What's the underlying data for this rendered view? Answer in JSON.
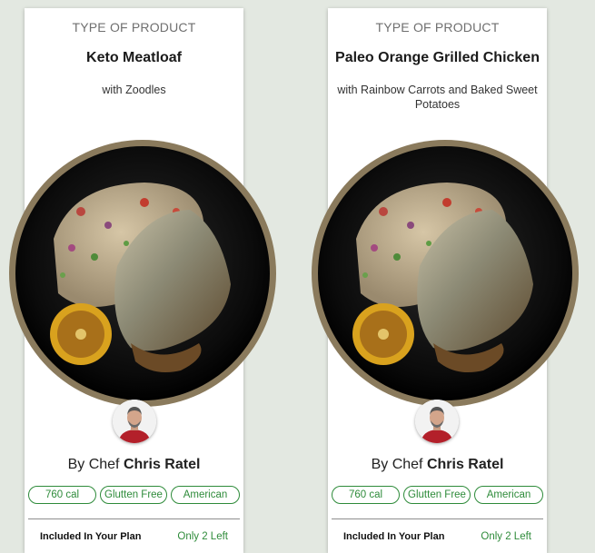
{
  "cards": [
    {
      "type_label": "TYPE OF PRODUCT",
      "title": "Keto Meatloaf",
      "subtitle": "with Zoodles",
      "chef_prefix": "By Chef",
      "chef_name": "Chris Ratel",
      "tags": [
        "760 cal",
        "Glutten Free",
        "American"
      ],
      "plan_label": "Included In Your Plan",
      "stock_label": "Only 2 Left"
    },
    {
      "type_label": "TYPE OF PRODUCT",
      "title": "Paleo Orange Grilled Chicken",
      "subtitle": "with Rainbow Carrots and Baked Sweet Potatoes",
      "chef_prefix": "By Chef",
      "chef_name": "Chris Ratel",
      "tags": [
        "760 cal",
        "Glutten Free",
        "American"
      ],
      "plan_label": "Included In Your Plan",
      "stock_label": "Only 2 Left"
    }
  ],
  "colors": {
    "accent_green": "#2e8b3a",
    "background": "#e3e8e1",
    "card": "#ffffff"
  }
}
